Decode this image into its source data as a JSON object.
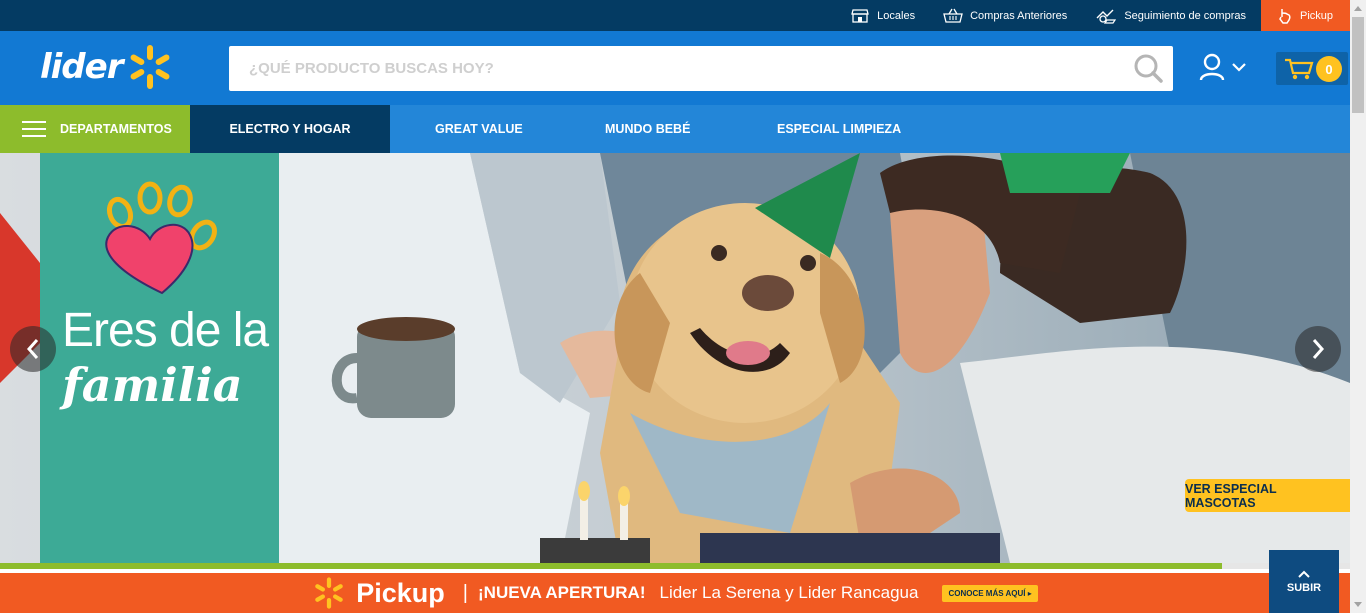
{
  "topbar": {
    "links": [
      {
        "label": "Locales",
        "icon": "store-icon"
      },
      {
        "label": "Compras Anteriores",
        "icon": "basket-icon"
      },
      {
        "label": "Seguimiento de compras",
        "icon": "tracking-icon"
      }
    ],
    "pickup_label": "Pickup"
  },
  "header": {
    "logo_text": "lider",
    "search_placeholder": "¿QUÉ PRODUCTO BUSCAS HOY?",
    "cart_count": "0"
  },
  "nav": {
    "departments_label": "DEPARTAMENTOS",
    "items": [
      "ELECTRO Y HOGAR",
      "GREAT VALUE",
      "MUNDO BEBÉ",
      "ESPECIAL LIMPIEZA"
    ]
  },
  "hero": {
    "title": "Eres de la",
    "subtitle": "familia",
    "cta_label": "VER ESPECIAL MASCOTAS",
    "progress_fraction": 0.905
  },
  "banner": {
    "brand": "Pickup",
    "separator": "|",
    "headline": "¡NUEVA APERTURA!",
    "text": "Lider La Serena y Lider Rancagua",
    "button": "CONOCE MÁS AQUÍ ▸"
  },
  "subir_label": "SUBIR",
  "colors": {
    "topbar": "#043b63",
    "header": "#1279d3",
    "nav": "#2386d8",
    "departments": "#8dbc2c",
    "accent_yellow": "#ffc220",
    "pickup_orange": "#f15a22"
  }
}
